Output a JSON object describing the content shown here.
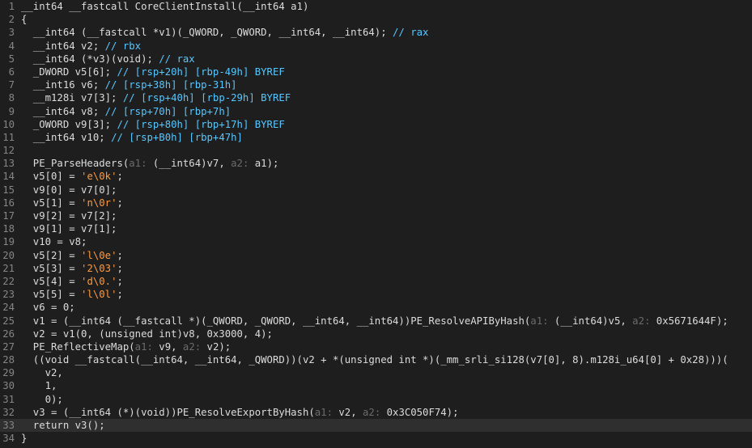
{
  "editor": {
    "colors": {
      "background": "#1e1e1e",
      "line_number": "#858585",
      "default_text": "#dcdcdc",
      "comment": "#57c7ff",
      "string_literal": "#ff9a3c",
      "param_hint": "#6b6b6b",
      "current_line": "#2f2f2f"
    },
    "current_line": 33,
    "lines": [
      {
        "n": "1",
        "tokens": [
          {
            "t": "plain",
            "s": "__int64 __fastcall CoreClientInstall(__int64 a1)"
          }
        ]
      },
      {
        "n": "2",
        "tokens": [
          {
            "t": "plain",
            "s": "{"
          }
        ]
      },
      {
        "n": "3",
        "tokens": [
          {
            "t": "plain",
            "s": "  __int64 (__fastcall *v1)(_QWORD, _QWORD, __int64, __int64); "
          },
          {
            "t": "comment",
            "s": "// rax"
          }
        ]
      },
      {
        "n": "4",
        "tokens": [
          {
            "t": "plain",
            "s": "  __int64 v2; "
          },
          {
            "t": "comment",
            "s": "// rbx"
          }
        ]
      },
      {
        "n": "5",
        "tokens": [
          {
            "t": "plain",
            "s": "  __int64 (*v3)(void); "
          },
          {
            "t": "comment",
            "s": "// rax"
          }
        ]
      },
      {
        "n": "6",
        "tokens": [
          {
            "t": "plain",
            "s": "  _DWORD v5[6]; "
          },
          {
            "t": "comment",
            "s": "// [rsp+20h] [rbp-49h] BYREF"
          }
        ]
      },
      {
        "n": "7",
        "tokens": [
          {
            "t": "plain",
            "s": "  __int16 v6; "
          },
          {
            "t": "comment",
            "s": "// [rsp+38h] [rbp-31h]"
          }
        ]
      },
      {
        "n": "8",
        "tokens": [
          {
            "t": "plain",
            "s": "  __m128i v7[3]; "
          },
          {
            "t": "comment",
            "s": "// [rsp+40h] [rbp-29h] BYREF"
          }
        ]
      },
      {
        "n": "9",
        "tokens": [
          {
            "t": "plain",
            "s": "  __int64 v8; "
          },
          {
            "t": "comment",
            "s": "// [rsp+70h] [rbp+7h]"
          }
        ]
      },
      {
        "n": "10",
        "tokens": [
          {
            "t": "plain",
            "s": "  _OWORD v9[3]; "
          },
          {
            "t": "comment",
            "s": "// [rsp+80h] [rbp+17h] BYREF"
          }
        ]
      },
      {
        "n": "11",
        "tokens": [
          {
            "t": "plain",
            "s": "  __int64 v10; "
          },
          {
            "t": "comment",
            "s": "// [rsp+B0h] [rbp+47h]"
          }
        ]
      },
      {
        "n": "12",
        "tokens": []
      },
      {
        "n": "13",
        "tokens": [
          {
            "t": "plain",
            "s": "  PE_ParseHeaders("
          },
          {
            "t": "hint",
            "s": "a1: "
          },
          {
            "t": "plain",
            "s": "(__int64)v7, "
          },
          {
            "t": "hint",
            "s": "a2: "
          },
          {
            "t": "plain",
            "s": "a1);"
          }
        ]
      },
      {
        "n": "14",
        "tokens": [
          {
            "t": "plain",
            "s": "  v5[0] = "
          },
          {
            "t": "string",
            "s": "'e\\0k'"
          },
          {
            "t": "plain",
            "s": ";"
          }
        ]
      },
      {
        "n": "15",
        "tokens": [
          {
            "t": "plain",
            "s": "  v9[0] = v7[0];"
          }
        ]
      },
      {
        "n": "16",
        "tokens": [
          {
            "t": "plain",
            "s": "  v5[1] = "
          },
          {
            "t": "string",
            "s": "'n\\0r'"
          },
          {
            "t": "plain",
            "s": ";"
          }
        ]
      },
      {
        "n": "17",
        "tokens": [
          {
            "t": "plain",
            "s": "  v9[2] = v7[2];"
          }
        ]
      },
      {
        "n": "18",
        "tokens": [
          {
            "t": "plain",
            "s": "  v9[1] = v7[1];"
          }
        ]
      },
      {
        "n": "19",
        "tokens": [
          {
            "t": "plain",
            "s": "  v10 = v8;"
          }
        ]
      },
      {
        "n": "20",
        "tokens": [
          {
            "t": "plain",
            "s": "  v5[2] = "
          },
          {
            "t": "string",
            "s": "'l\\0e'"
          },
          {
            "t": "plain",
            "s": ";"
          }
        ]
      },
      {
        "n": "21",
        "tokens": [
          {
            "t": "plain",
            "s": "  v5[3] = "
          },
          {
            "t": "string",
            "s": "'2\\03'"
          },
          {
            "t": "plain",
            "s": ";"
          }
        ]
      },
      {
        "n": "22",
        "tokens": [
          {
            "t": "plain",
            "s": "  v5[4] = "
          },
          {
            "t": "string",
            "s": "'d\\0.'"
          },
          {
            "t": "plain",
            "s": ";"
          }
        ]
      },
      {
        "n": "23",
        "tokens": [
          {
            "t": "plain",
            "s": "  v5[5] = "
          },
          {
            "t": "string",
            "s": "'l\\0l'"
          },
          {
            "t": "plain",
            "s": ";"
          }
        ]
      },
      {
        "n": "24",
        "tokens": [
          {
            "t": "plain",
            "s": "  v6 = 0;"
          }
        ]
      },
      {
        "n": "25",
        "tokens": [
          {
            "t": "plain",
            "s": "  v1 = (__int64 (__fastcall *)(_QWORD, _QWORD, __int64, __int64))PE_ResolveAPIByHash("
          },
          {
            "t": "hint",
            "s": "a1: "
          },
          {
            "t": "plain",
            "s": "(__int64)v5, "
          },
          {
            "t": "hint",
            "s": "a2: "
          },
          {
            "t": "plain",
            "s": "0x5671644F);"
          }
        ]
      },
      {
        "n": "26",
        "tokens": [
          {
            "t": "plain",
            "s": "  v2 = v1(0, (unsigned int)v8, 0x3000, 4);"
          }
        ]
      },
      {
        "n": "27",
        "tokens": [
          {
            "t": "plain",
            "s": "  PE_ReflectiveMap("
          },
          {
            "t": "hint",
            "s": "a1: "
          },
          {
            "t": "plain",
            "s": "v9, "
          },
          {
            "t": "hint",
            "s": "a2: "
          },
          {
            "t": "plain",
            "s": "v2);"
          }
        ]
      },
      {
        "n": "28",
        "tokens": [
          {
            "t": "plain",
            "s": "  ((void __fastcall(__int64, __int64, _QWORD))(v2 + *(unsigned int *)(_mm_srli_si128(v7[0], 8).m128i_u64[0] + 0x28)))("
          }
        ]
      },
      {
        "n": "29",
        "tokens": [
          {
            "t": "plain",
            "s": "    v2,"
          }
        ]
      },
      {
        "n": "30",
        "tokens": [
          {
            "t": "plain",
            "s": "    1,"
          }
        ]
      },
      {
        "n": "31",
        "tokens": [
          {
            "t": "plain",
            "s": "    0);"
          }
        ]
      },
      {
        "n": "32",
        "tokens": [
          {
            "t": "plain",
            "s": "  v3 = (__int64 (*)(void))PE_ResolveExportByHash("
          },
          {
            "t": "hint",
            "s": "a1: "
          },
          {
            "t": "plain",
            "s": "v2, "
          },
          {
            "t": "hint",
            "s": "a2: "
          },
          {
            "t": "plain",
            "s": "0x3C050F74);"
          }
        ]
      },
      {
        "n": "33",
        "tokens": [
          {
            "t": "plain",
            "s": "  return v3();"
          }
        ]
      },
      {
        "n": "34",
        "tokens": [
          {
            "t": "plain",
            "s": "}"
          }
        ]
      }
    ]
  }
}
